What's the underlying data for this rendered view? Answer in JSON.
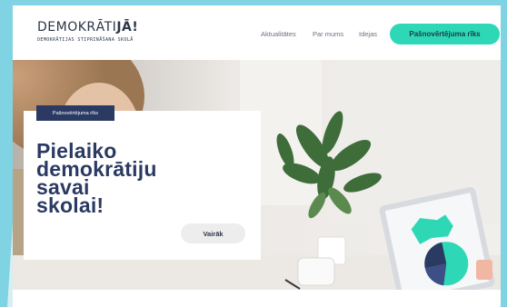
{
  "header": {
    "logo": {
      "name_light": "DEMOKRĀTI",
      "name_bold": "JĀ!",
      "tagline": "DEMOKRĀTIJAS STIPRINĀŠANA SKOLĀ"
    },
    "nav": [
      {
        "label": "Aktualitātes"
      },
      {
        "label": "Par mums"
      },
      {
        "label": "Idejas"
      }
    ],
    "cta_label": "Pašnovērtējuma rīks"
  },
  "hero": {
    "tag": "Pašnovērtējuma rīks",
    "heading_lines": [
      "Pielaiko",
      "demokrātiju",
      "savai",
      "skolai!"
    ],
    "button_label": "Vairāk"
  },
  "colors": {
    "frame": "#7fd3e3",
    "accent": "#2ed8b6",
    "navy": "#2b3a63",
    "text_dark": "#2b3648"
  }
}
